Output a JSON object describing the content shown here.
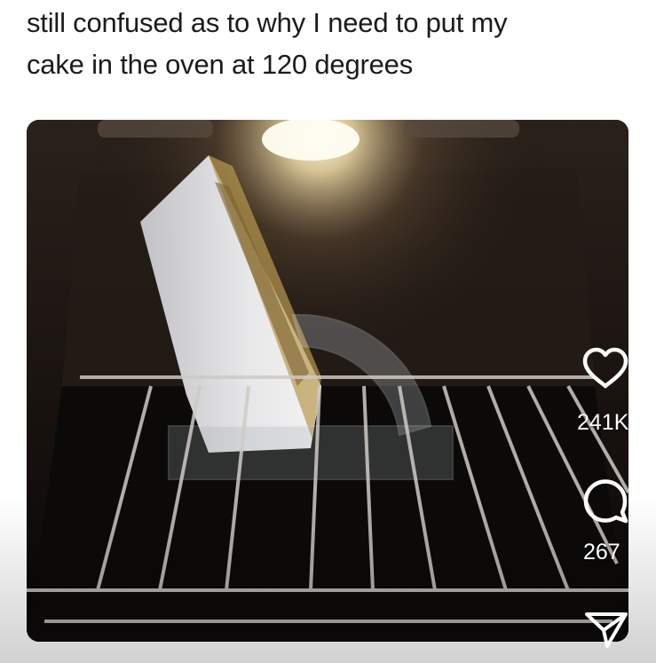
{
  "post": {
    "caption_line1": "still confused as to why I need to put my",
    "caption_line2": "cake in the oven at 120 degrees"
  },
  "actions": {
    "likes_count": "241K",
    "comments_count": "267"
  },
  "icons": {
    "like": "heart-icon",
    "comment": "comment-bubble-icon",
    "share": "send-icon"
  },
  "colors": {
    "text": "#1b1b1b",
    "overlay_icons": "#ffffff"
  }
}
